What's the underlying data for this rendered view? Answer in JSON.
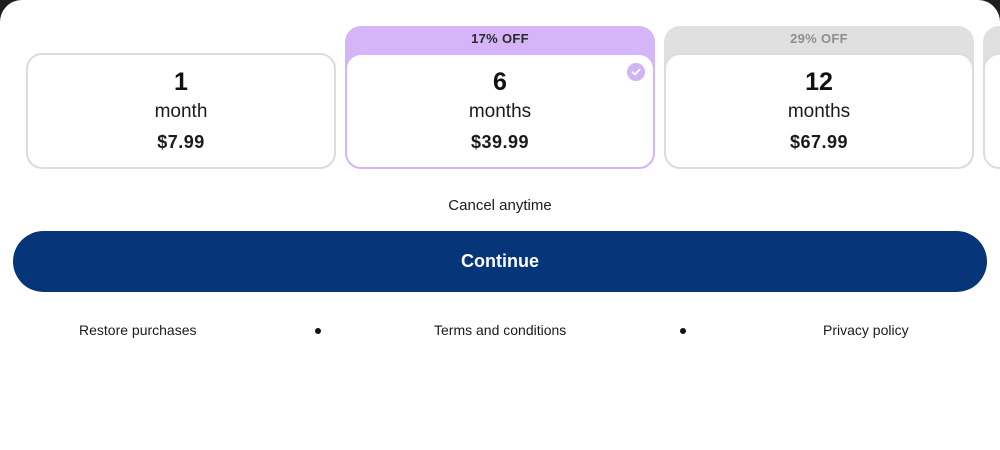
{
  "plans": [
    {
      "quantity": "1",
      "unit": "month",
      "price": "$7.99",
      "badge": ""
    },
    {
      "quantity": "6",
      "unit": "months",
      "price": "$39.99",
      "badge": "17% OFF",
      "selected": true
    },
    {
      "quantity": "12",
      "unit": "months",
      "price": "$67.99",
      "badge": "29% OFF"
    }
  ],
  "cancel_text": "Cancel anytime",
  "continue_label": "Continue",
  "footer": {
    "restore": "Restore purchases",
    "terms": "Terms and conditions",
    "privacy": "Privacy policy"
  },
  "colors": {
    "accent_purple": "#d5b4f8",
    "primary_button": "#06357a",
    "inactive_badge": "#e0e0e0"
  },
  "icons": {
    "selected": "check-circle-icon",
    "separator": "dot-separator-icon"
  }
}
